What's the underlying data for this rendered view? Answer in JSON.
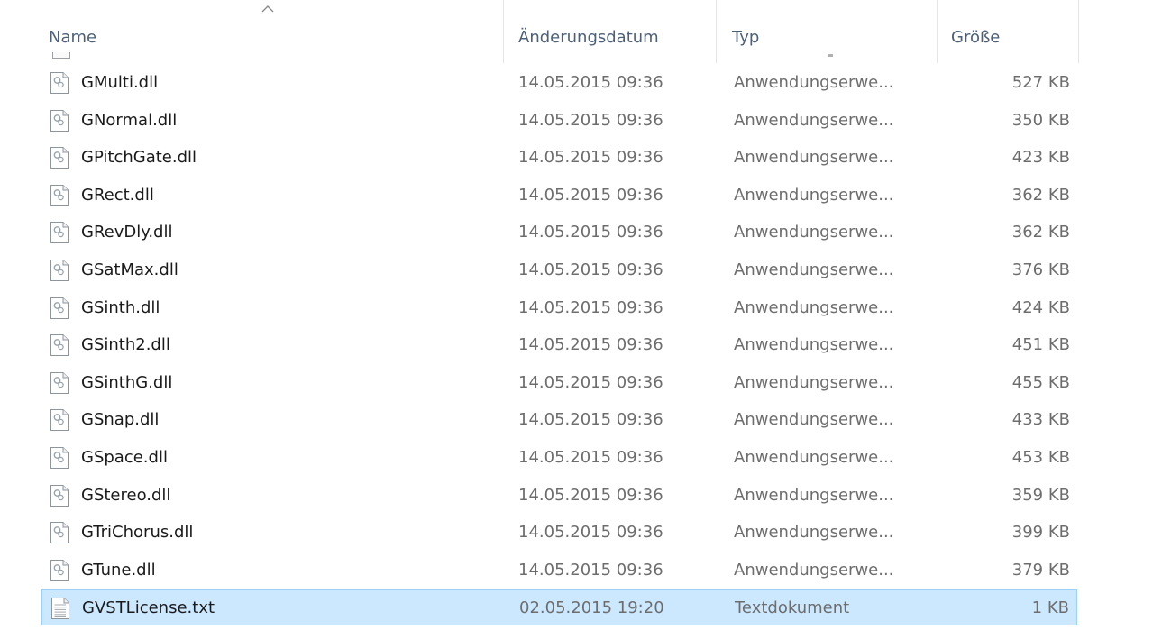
{
  "columns": {
    "name": "Name",
    "date": "Änderungsdatum",
    "type": "Typ",
    "size": "Größe"
  },
  "sort": {
    "column": "name",
    "direction": "ascending",
    "icon": "sort-up-chevron-icon"
  },
  "files": [
    {
      "name": "GMulti.dll",
      "date": "14.05.2015 09:36",
      "type": "Anwendungserwe...",
      "size": "527 KB",
      "icon": "dll-file-icon",
      "selected": false
    },
    {
      "name": "GNormal.dll",
      "date": "14.05.2015 09:36",
      "type": "Anwendungserwe...",
      "size": "350 KB",
      "icon": "dll-file-icon",
      "selected": false
    },
    {
      "name": "GPitchGate.dll",
      "date": "14.05.2015 09:36",
      "type": "Anwendungserwe...",
      "size": "423 KB",
      "icon": "dll-file-icon",
      "selected": false
    },
    {
      "name": "GRect.dll",
      "date": "14.05.2015 09:36",
      "type": "Anwendungserwe...",
      "size": "362 KB",
      "icon": "dll-file-icon",
      "selected": false
    },
    {
      "name": "GRevDly.dll",
      "date": "14.05.2015 09:36",
      "type": "Anwendungserwe...",
      "size": "362 KB",
      "icon": "dll-file-icon",
      "selected": false
    },
    {
      "name": "GSatMax.dll",
      "date": "14.05.2015 09:36",
      "type": "Anwendungserwe...",
      "size": "376 KB",
      "icon": "dll-file-icon",
      "selected": false
    },
    {
      "name": "GSinth.dll",
      "date": "14.05.2015 09:36",
      "type": "Anwendungserwe...",
      "size": "424 KB",
      "icon": "dll-file-icon",
      "selected": false
    },
    {
      "name": "GSinth2.dll",
      "date": "14.05.2015 09:36",
      "type": "Anwendungserwe...",
      "size": "451 KB",
      "icon": "dll-file-icon",
      "selected": false
    },
    {
      "name": "GSinthG.dll",
      "date": "14.05.2015 09:36",
      "type": "Anwendungserwe...",
      "size": "455 KB",
      "icon": "dll-file-icon",
      "selected": false
    },
    {
      "name": "GSnap.dll",
      "date": "14.05.2015 09:36",
      "type": "Anwendungserwe...",
      "size": "433 KB",
      "icon": "dll-file-icon",
      "selected": false
    },
    {
      "name": "GSpace.dll",
      "date": "14.05.2015 09:36",
      "type": "Anwendungserwe...",
      "size": "453 KB",
      "icon": "dll-file-icon",
      "selected": false
    },
    {
      "name": "GStereo.dll",
      "date": "14.05.2015 09:36",
      "type": "Anwendungserwe...",
      "size": "359 KB",
      "icon": "dll-file-icon",
      "selected": false
    },
    {
      "name": "GTriChorus.dll",
      "date": "14.05.2015 09:36",
      "type": "Anwendungserwe...",
      "size": "399 KB",
      "icon": "dll-file-icon",
      "selected": false
    },
    {
      "name": "GTune.dll",
      "date": "14.05.2015 09:36",
      "type": "Anwendungserwe...",
      "size": "379 KB",
      "icon": "dll-file-icon",
      "selected": false
    },
    {
      "name": "GVSTLicense.txt",
      "date": "02.05.2015 19:20",
      "type": "Textdokument",
      "size": "1 KB",
      "icon": "text-document-icon",
      "selected": true
    }
  ],
  "colors": {
    "selection_fill": "#cce8ff",
    "selection_border": "#99d1ff",
    "header_text": "#4c607a",
    "detail_text": "#6d6d6d"
  }
}
